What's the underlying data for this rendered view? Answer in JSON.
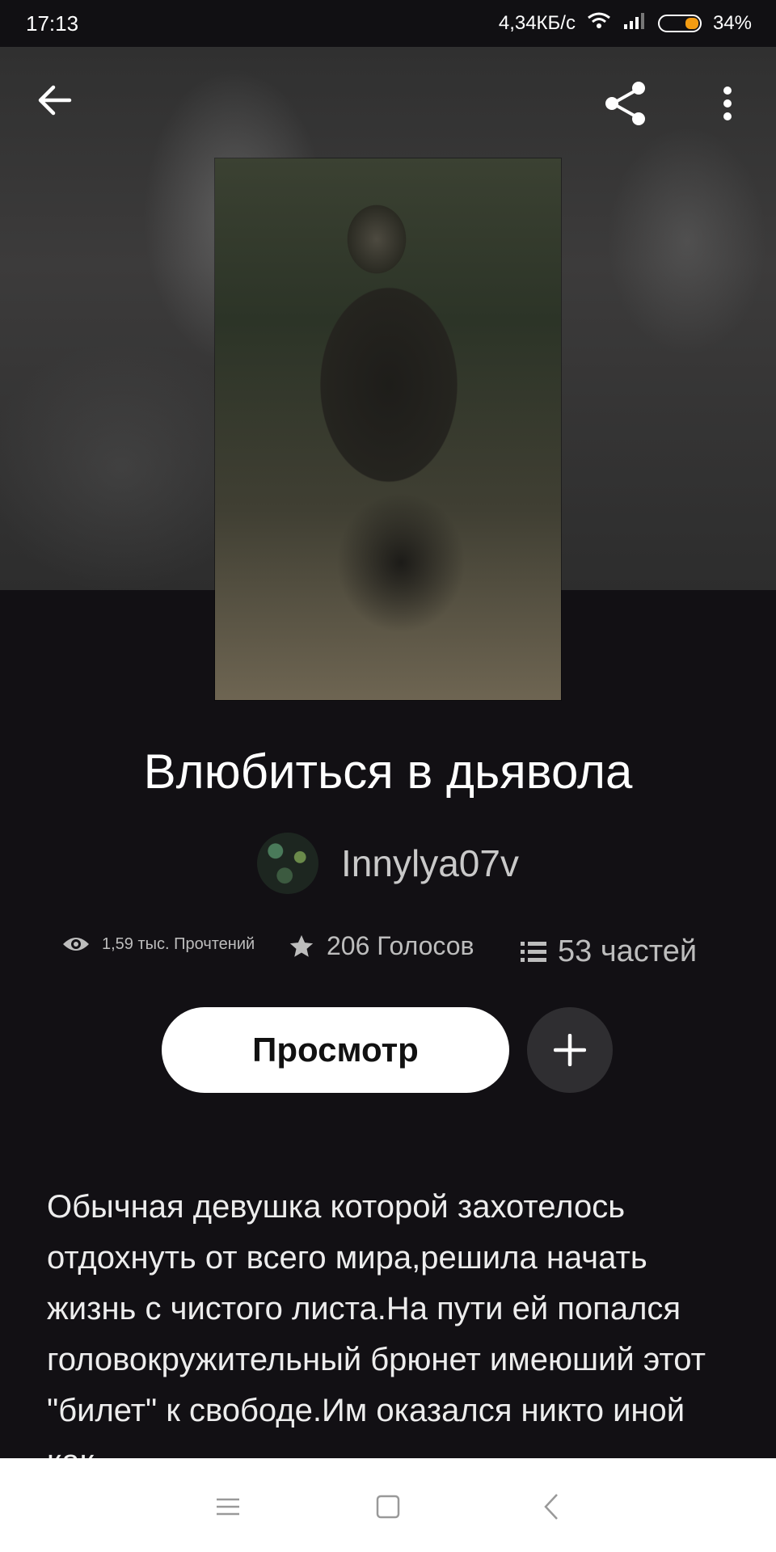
{
  "status_bar": {
    "time": "17:13",
    "network_speed": "4,34КБ/с",
    "battery_percent": "34%",
    "battery_level": 0.34,
    "battery_color": "#f39c12"
  },
  "header": {
    "back_icon": "arrow-left-icon",
    "share_icon": "share-icon",
    "more_icon": "more-vertical-icon"
  },
  "story": {
    "title": "Влюбиться в дьявола",
    "author": "Innylya07v",
    "stats": {
      "reads": "1,59 тыс. Прочтений",
      "votes": "206 Голосов",
      "parts": "53 частей"
    },
    "read_button_label": "Просмотр",
    "add_button_icon": "plus-icon",
    "description": "Обычная девушка которой захотелось отдохнуть от всего мира,решила начать жизнь с чистого листа.На пути ей попался головокружительный брюнет имеюший этот \"билет\" к свободе.Им оказался никто иной как"
  },
  "nav_bar": {
    "menu_icon": "menu-icon",
    "home_icon": "square-home-icon",
    "back_icon": "chevron-left-icon"
  }
}
